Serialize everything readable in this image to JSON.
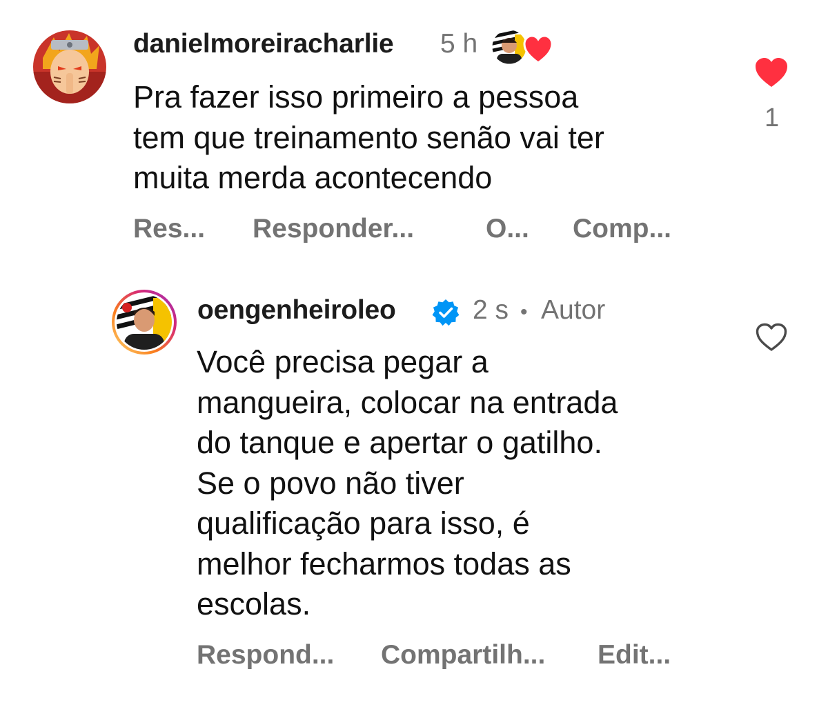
{
  "comment": {
    "username": "danielmoreiracharlie",
    "time": "5 h",
    "text_lines": [
      "Pra fazer isso primeiro a pessoa",
      "tem que treinamento senão vai ter",
      "muita merda acontecendo"
    ],
    "like_count": "1",
    "liked": true,
    "actions": [
      "Res...",
      "Responder...",
      "O...",
      "Comp..."
    ]
  },
  "reply": {
    "username": "oengenheiroleo",
    "verified": true,
    "time": "2 s",
    "separator": "•",
    "role": "Autor",
    "text_lines": [
      "Você precisa pegar a",
      "mangueira, colocar na entrada",
      "do tanque e apertar o gatilho.",
      "Se o povo não tiver",
      "qualificação para isso, é",
      "melhor fecharmos todas as",
      "escolas."
    ],
    "liked": false,
    "actions": [
      "Respond...",
      "Compartilh...",
      "Edit..."
    ]
  },
  "colors": {
    "like_red": "#ff3040",
    "verified_blue": "#0095f6",
    "muted_gray": "#737373",
    "ring_gradient": [
      "#feda75",
      "#fa7e1e",
      "#d62976",
      "#962fbf"
    ]
  },
  "icons": [
    "heart-filled-icon",
    "heart-outline-icon",
    "verified-badge-icon",
    "author-liked-badge-icon"
  ]
}
